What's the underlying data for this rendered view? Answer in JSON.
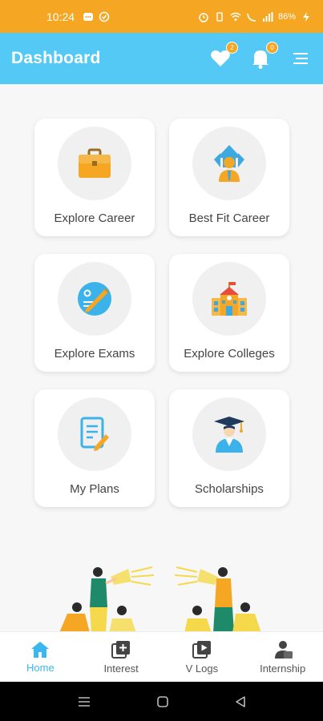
{
  "status_bar": {
    "time": "10:24",
    "battery": "86%"
  },
  "app_bar": {
    "title": "Dashboard",
    "favorites_count": "2",
    "notifications_count": "0"
  },
  "cards": [
    {
      "label": "Explore Career",
      "icon": "briefcase-icon"
    },
    {
      "label": "Best Fit Career",
      "icon": "career-growth-icon"
    },
    {
      "label": "Explore Exams",
      "icon": "exam-icon"
    },
    {
      "label": "Explore Colleges",
      "icon": "college-icon"
    },
    {
      "label": "My Plans",
      "icon": "plans-icon"
    },
    {
      "label": "Scholarships",
      "icon": "graduate-icon"
    }
  ],
  "bottom_nav": [
    {
      "label": "Home",
      "icon": "home-icon",
      "active": true
    },
    {
      "label": "Interest",
      "icon": "interest-icon"
    },
    {
      "label": "V Logs",
      "icon": "vlogs-icon"
    },
    {
      "label": "Internship",
      "icon": "internship-icon"
    }
  ],
  "colors": {
    "status": "#f5a623",
    "appbar": "#55c9f5",
    "accent": "#39b7ee"
  }
}
